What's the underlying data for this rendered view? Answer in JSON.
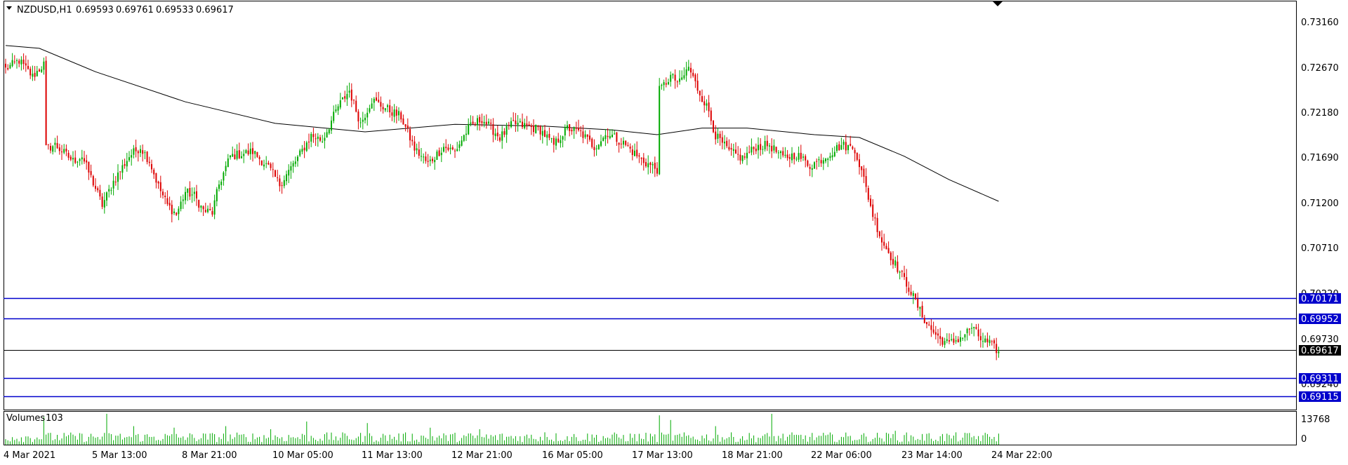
{
  "chart_data": {
    "type": "candlestick",
    "symbol_line": {
      "symbol": "NZDUSD,H1",
      "open": "0.69593",
      "high": "0.69761",
      "low": "0.69533",
      "close": "0.69617"
    },
    "ylim": [
      0.69,
      0.7335
    ],
    "y_ticks": [
      "0.73160",
      "0.72670",
      "0.72180",
      "0.71690",
      "0.71200",
      "0.70710",
      "0.70220",
      "0.69730",
      "0.69240"
    ],
    "x_ticks": [
      "4 Mar 2021",
      "5 Mar 13:00",
      "8 Mar 21:00",
      "10 Mar 05:00",
      "11 Mar 13:00",
      "12 Mar 21:00",
      "16 Mar 05:00",
      "17 Mar 13:00",
      "18 Mar 21:00",
      "22 Mar 06:00",
      "23 Mar 14:00",
      "24 Mar 22:00"
    ],
    "horizontal_levels": [
      {
        "value": "0.70171",
        "color": "#0000cc"
      },
      {
        "value": "0.69952",
        "color": "#0000cc"
      },
      {
        "value": "0.69311",
        "color": "#0000cc"
      },
      {
        "value": "0.69115",
        "color": "#0000cc"
      }
    ],
    "current_price": {
      "value": "0.69617",
      "color": "#000000"
    },
    "price_path": [
      [
        0,
        0.7263
      ],
      [
        6,
        0.7272
      ],
      [
        12,
        0.7255
      ],
      [
        17,
        0.7268
      ],
      [
        18,
        0.7178
      ],
      [
        22,
        0.7182
      ],
      [
        30,
        0.7165
      ],
      [
        34,
        0.717
      ],
      [
        40,
        0.7136
      ],
      [
        43,
        0.7118
      ],
      [
        48,
        0.7143
      ],
      [
        55,
        0.717
      ],
      [
        60,
        0.718
      ],
      [
        64,
        0.7165
      ],
      [
        68,
        0.7138
      ],
      [
        72,
        0.7118
      ],
      [
        76,
        0.7108
      ],
      [
        80,
        0.7132
      ],
      [
        84,
        0.7128
      ],
      [
        88,
        0.7112
      ],
      [
        92,
        0.711
      ],
      [
        95,
        0.714
      ],
      [
        100,
        0.717
      ],
      [
        110,
        0.7175
      ],
      [
        117,
        0.7158
      ],
      [
        122,
        0.714
      ],
      [
        130,
        0.7168
      ],
      [
        136,
        0.7192
      ],
      [
        141,
        0.7187
      ],
      [
        148,
        0.7223
      ],
      [
        153,
        0.724
      ],
      [
        158,
        0.7205
      ],
      [
        163,
        0.723
      ],
      [
        170,
        0.722
      ],
      [
        176,
        0.7212
      ],
      [
        182,
        0.7178
      ],
      [
        188,
        0.7162
      ],
      [
        195,
        0.718
      ],
      [
        200,
        0.7175
      ],
      [
        206,
        0.72
      ],
      [
        212,
        0.721
      ],
      [
        220,
        0.719
      ],
      [
        226,
        0.7205
      ],
      [
        232,
        0.7202
      ],
      [
        238,
        0.7198
      ],
      [
        244,
        0.7182
      ],
      [
        250,
        0.72
      ],
      [
        256,
        0.7195
      ],
      [
        262,
        0.718
      ],
      [
        268,
        0.7195
      ],
      [
        276,
        0.7182
      ],
      [
        283,
        0.7166
      ],
      [
        290,
        0.7156
      ],
      [
        291,
        0.724
      ],
      [
        296,
        0.7255
      ],
      [
        300,
        0.7248
      ],
      [
        304,
        0.7265
      ],
      [
        308,
        0.7242
      ],
      [
        313,
        0.7218
      ],
      [
        316,
        0.7192
      ],
      [
        322,
        0.7175
      ],
      [
        328,
        0.7168
      ],
      [
        334,
        0.718
      ],
      [
        340,
        0.7182
      ],
      [
        346,
        0.7168
      ],
      [
        352,
        0.7172
      ],
      [
        358,
        0.716
      ],
      [
        364,
        0.7168
      ],
      [
        372,
        0.7182
      ],
      [
        378,
        0.7178
      ],
      [
        382,
        0.7145
      ],
      [
        386,
        0.7108
      ],
      [
        390,
        0.708
      ],
      [
        396,
        0.7055
      ],
      [
        402,
        0.703
      ],
      [
        408,
        0.7
      ],
      [
        412,
        0.6985
      ],
      [
        416,
        0.6975
      ],
      [
        420,
        0.697
      ],
      [
        426,
        0.6978
      ],
      [
        430,
        0.6988
      ],
      [
        434,
        0.6975
      ],
      [
        438,
        0.697
      ],
      [
        442,
        0.6962
      ]
    ],
    "ma_path": [
      [
        0,
        0.7288
      ],
      [
        15,
        0.7285
      ],
      [
        40,
        0.726
      ],
      [
        80,
        0.7228
      ],
      [
        120,
        0.7205
      ],
      [
        160,
        0.7196
      ],
      [
        200,
        0.7204
      ],
      [
        240,
        0.7202
      ],
      [
        270,
        0.7198
      ],
      [
        290,
        0.7193
      ],
      [
        310,
        0.72
      ],
      [
        330,
        0.72
      ],
      [
        360,
        0.7193
      ],
      [
        380,
        0.719
      ],
      [
        400,
        0.717
      ],
      [
        420,
        0.7145
      ],
      [
        442,
        0.7122
      ]
    ],
    "volumes_panel": {
      "label": "Volumes",
      "last_value": "103",
      "y_ticks": [
        "13768",
        "0"
      ],
      "max": 13768,
      "color": "#00aa00",
      "spike_bars": [
        [
          17,
          0.9
        ],
        [
          45,
          1.0
        ],
        [
          57,
          0.6
        ],
        [
          75,
          0.55
        ],
        [
          98,
          0.6
        ],
        [
          118,
          0.5
        ],
        [
          134,
          0.75
        ],
        [
          161,
          0.7
        ],
        [
          189,
          0.55
        ],
        [
          211,
          0.5
        ],
        [
          240,
          0.4
        ],
        [
          291,
          0.95
        ],
        [
          296,
          0.8
        ],
        [
          316,
          0.6
        ],
        [
          341,
          1.0
        ],
        [
          396,
          0.45
        ],
        [
          440,
          0.25
        ]
      ]
    }
  },
  "colors": {
    "bull": "#00aa00",
    "bear": "#dd0000",
    "ma": "#000000",
    "level": "#0000cc"
  }
}
